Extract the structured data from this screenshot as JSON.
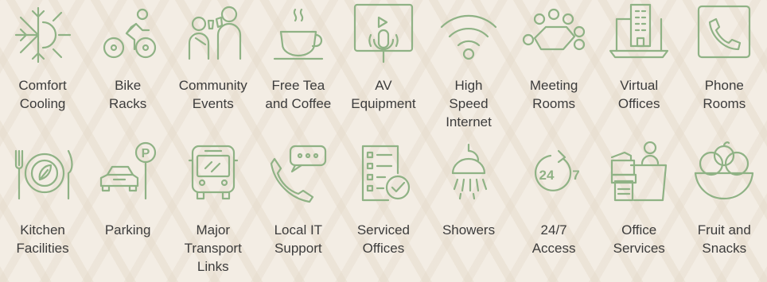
{
  "amenities": [
    {
      "label": "Comfort\nCooling",
      "icon": "snowflake-sun-icon"
    },
    {
      "label": "Bike\nRacks",
      "icon": "bike-rider-icon"
    },
    {
      "label": "Community\nEvents",
      "icon": "people-toast-icon"
    },
    {
      "label": "Free Tea\nand Coffee",
      "icon": "steaming-cup-icon"
    },
    {
      "label": "AV\nEquipment",
      "icon": "screen-microphone-icon"
    },
    {
      "label": "High\nSpeed\nInternet",
      "icon": "wifi-icon"
    },
    {
      "label": "Meeting\nRooms",
      "icon": "conference-table-icon"
    },
    {
      "label": "Virtual\nOffices",
      "icon": "laptop-building-icon"
    },
    {
      "label": "Phone\nRooms",
      "icon": "phone-icon"
    },
    {
      "label": "Kitchen\nFacilities",
      "icon": "plate-cutlery-icon"
    },
    {
      "label": "Parking",
      "icon": "car-parking-icon"
    },
    {
      "label": "Major\nTransport\nLinks",
      "icon": "bus-icon"
    },
    {
      "label": "Local IT\nSupport",
      "icon": "phone-chat-icon"
    },
    {
      "label": "Serviced\nOffices",
      "icon": "checklist-icon"
    },
    {
      "label": "Showers",
      "icon": "shower-head-icon"
    },
    {
      "label": "24/7\nAccess",
      "icon": "clock-24-7-icon"
    },
    {
      "label": "Office\nServices",
      "icon": "printer-desk-icon"
    },
    {
      "label": "Fruit and\nSnacks",
      "icon": "fruit-bowl-icon"
    }
  ],
  "icon_text": {
    "parking": "P",
    "hours": "24",
    "days": "7"
  },
  "colors": {
    "icon": "#8fb285",
    "text": "#3c3c3c",
    "background": "#f3ede4"
  }
}
